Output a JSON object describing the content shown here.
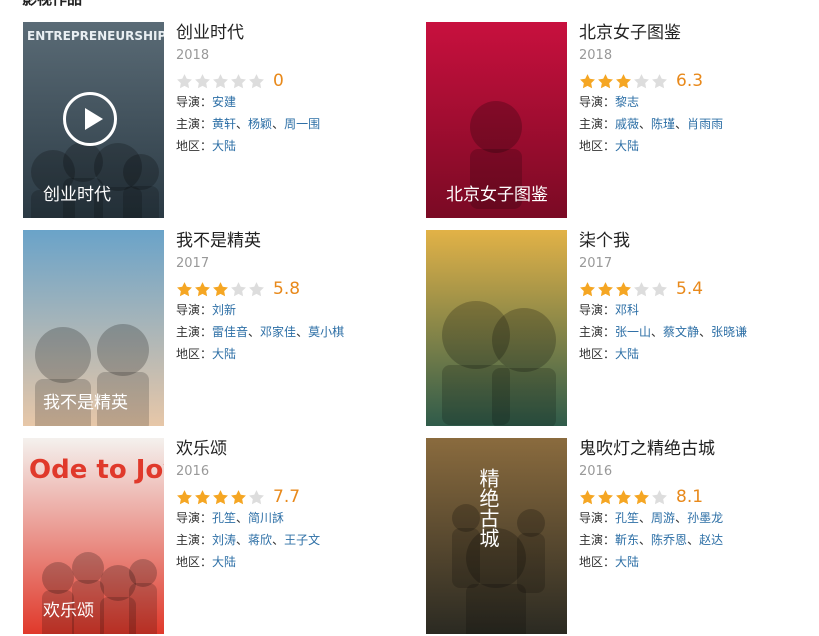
{
  "section_title": "影视作品",
  "labels": {
    "director": "导演：",
    "cast": "主演：",
    "region": "地区："
  },
  "star_color_on": "#f5a623",
  "star_color_off": "#ddd",
  "items": [
    {
      "title": "创业时代",
      "year": "2018",
      "stars": 0,
      "score": "0",
      "director": [
        "安建"
      ],
      "cast": [
        "黄轩",
        "杨颖",
        "周一围"
      ],
      "region": "大陆",
      "poster_text": "ENTREPRENEURSHIP",
      "poster_caption": "创业时代",
      "has_play_icon": true
    },
    {
      "title": "北京女子图鉴",
      "year": "2018",
      "stars": 3,
      "score": "6.3",
      "director": [
        "黎志"
      ],
      "cast": [
        "戚薇",
        "陈瑾",
        "肖雨雨"
      ],
      "region": "大陆",
      "poster_caption": "北京女子图鉴"
    },
    {
      "title": "我不是精英",
      "year": "2017",
      "stars": 3,
      "score": "5.8",
      "director": [
        "刘新"
      ],
      "cast": [
        "雷佳音",
        "邓家佳",
        "莫小棋"
      ],
      "region": "大陆",
      "poster_caption": "我不是精英"
    },
    {
      "title": "柒个我",
      "year": "2017",
      "stars": 3,
      "score": "5.4",
      "director": [
        "邓科"
      ],
      "cast": [
        "张一山",
        "蔡文静",
        "张晓谦"
      ],
      "region": "大陆"
    },
    {
      "title": "欢乐颂",
      "year": "2016",
      "stars": 4,
      "score": "7.7",
      "director": [
        "孔笙",
        "简川訸"
      ],
      "cast": [
        "刘涛",
        "蒋欣",
        "王子文"
      ],
      "region": "大陆",
      "poster_text": "Ode to Joy",
      "poster_caption": "欢乐颂"
    },
    {
      "title": "鬼吹灯之精绝古城",
      "year": "2016",
      "stars": 4,
      "score": "8.1",
      "director": [
        "孔笙",
        "周游",
        "孙墨龙"
      ],
      "cast": [
        "靳东",
        "陈乔恩",
        "赵达"
      ],
      "region": "大陆",
      "poster_caption": "精绝古城"
    }
  ]
}
